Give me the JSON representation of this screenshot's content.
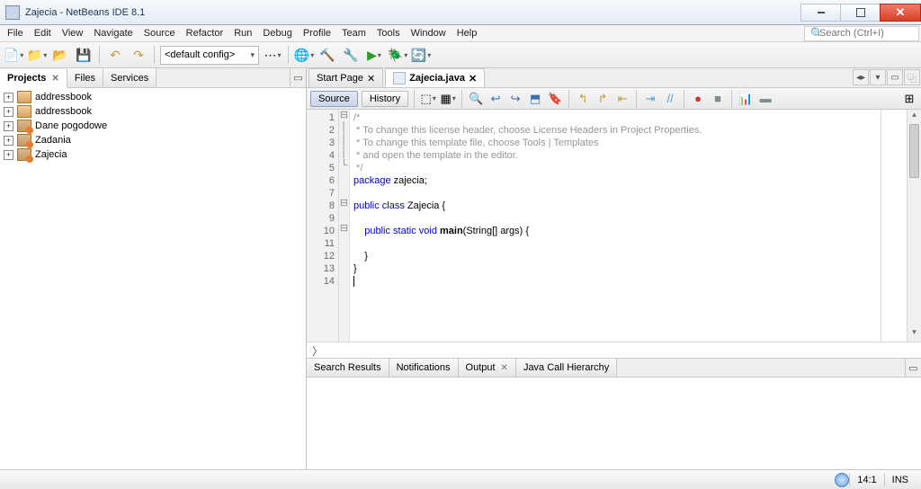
{
  "window": {
    "title": "Zajecia - NetBeans IDE 8.1"
  },
  "menubar": [
    "File",
    "Edit",
    "View",
    "Navigate",
    "Source",
    "Refactor",
    "Run",
    "Debug",
    "Profile",
    "Team",
    "Tools",
    "Window",
    "Help"
  ],
  "search": {
    "placeholder": "Search (Ctrl+I)"
  },
  "toolbar": {
    "config_label": "<default config>"
  },
  "leftpane": {
    "tabs": [
      "Projects",
      "Files",
      "Services"
    ],
    "active_tab": 0,
    "projects": [
      {
        "name": "addressbook",
        "kind": "book"
      },
      {
        "name": "addressbook",
        "kind": "book"
      },
      {
        "name": "Dane pogodowe",
        "kind": "java"
      },
      {
        "name": "Zadania",
        "kind": "java"
      },
      {
        "name": "Zajecia",
        "kind": "java"
      }
    ]
  },
  "editor": {
    "tabs": [
      {
        "label": "Start Page",
        "closable": true,
        "active": false
      },
      {
        "label": "Zajecia.java",
        "closable": true,
        "active": true
      }
    ],
    "subtabs": {
      "source": "Source",
      "history": "History",
      "active": "source"
    },
    "lines": [
      1,
      2,
      3,
      4,
      5,
      6,
      7,
      8,
      9,
      10,
      11,
      12,
      13,
      14
    ],
    "code": {
      "l1": "/*",
      "l2": " * To change this license header, choose License Headers in Project Properties.",
      "l3": " * To change this template file, choose Tools | Templates",
      "l4": " * and open the template in the editor.",
      "l5": " */",
      "l6a": "package",
      "l6b": " zajecia;",
      "l8a": "public class",
      "l8b": " Zajecia {",
      "l10a": "    public static void",
      "l10b": " main",
      "l10c": "(String[] args) {",
      "l12": "    }",
      "l13": "}"
    },
    "breadcrumb": "〉"
  },
  "bottom": {
    "tabs": [
      "Search Results",
      "Notifications",
      "Output",
      "Java Call Hierarchy"
    ],
    "active_tab": 2
  },
  "status": {
    "pos": "14:1",
    "mode": "INS"
  }
}
